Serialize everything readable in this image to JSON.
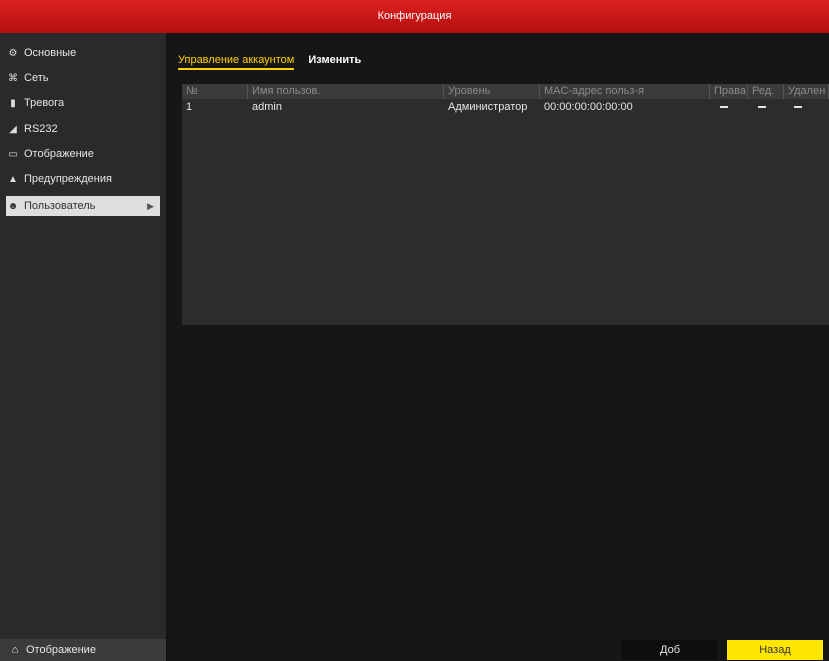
{
  "window": {
    "title": "Конфигурация"
  },
  "sidebar": {
    "items": [
      {
        "label": "Основные",
        "icon": "settings-icon"
      },
      {
        "label": "Сеть",
        "icon": "network-icon"
      },
      {
        "label": "Тревога",
        "icon": "alarm-icon"
      },
      {
        "label": "RS232",
        "icon": "rs232-icon"
      },
      {
        "label": "Отображение",
        "icon": "display-icon"
      },
      {
        "label": "Предупреждения",
        "icon": "warning-icon"
      },
      {
        "label": "Пользователь",
        "icon": "user-icon",
        "active": true
      }
    ],
    "bottom": {
      "label": "Отображение",
      "icon": "home-icon"
    }
  },
  "tabs": [
    {
      "label": "Управление аккаунтом",
      "active": true
    },
    {
      "label": "Изменить",
      "active": false
    }
  ],
  "table": {
    "headers": [
      "№",
      "Имя пользов.",
      "Уровень",
      "MAC-адрес польз-я",
      "Права",
      "Ред.",
      "Удален"
    ],
    "rows": [
      {
        "no": "1",
        "name": "admin",
        "level": "Администратор",
        "mac": "00:00:00:00:00:00",
        "c1": "",
        "c2": "",
        "c3": ""
      }
    ]
  },
  "buttons": {
    "add": "Доб",
    "back": "Назад"
  },
  "colors": {
    "title_bar": "#c91616",
    "accent": "#ffd100",
    "back_button": "#ffe600"
  }
}
